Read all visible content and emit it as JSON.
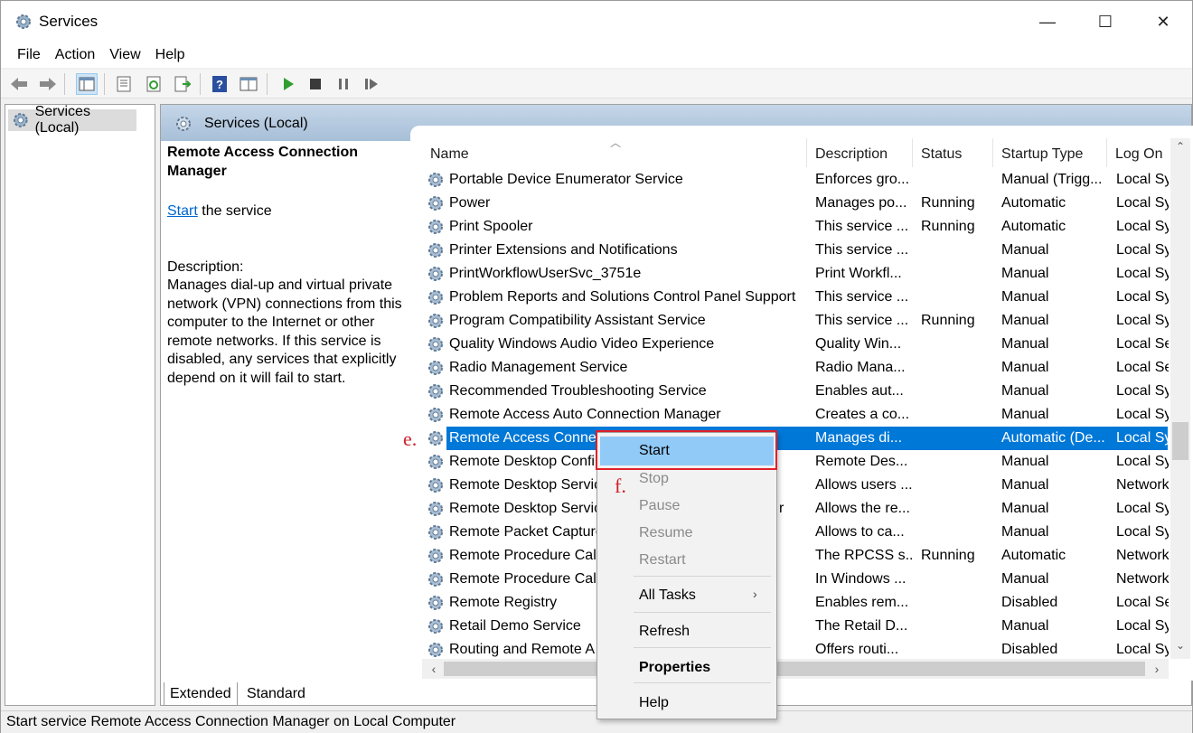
{
  "window": {
    "title": "Services",
    "controls": {
      "minimize": "—",
      "maximize": "☐",
      "close": "✕"
    }
  },
  "menu": [
    "File",
    "Action",
    "View",
    "Help"
  ],
  "toolbar": {
    "icons": [
      "back-arrow-icon",
      "forward-arrow-icon",
      "show-console-tree-icon",
      "properties-icon",
      "refresh-icon",
      "export-list-icon",
      "help-icon",
      "console-view-icon",
      "play-icon",
      "stop-icon",
      "pause-icon",
      "restart-icon"
    ]
  },
  "tree": {
    "root_label": "Services (Local)"
  },
  "pane": {
    "header": "Services (Local)"
  },
  "description": {
    "service_name_line1": "Remote Access Connection",
    "service_name_line2": "Manager",
    "start_link": "Start",
    "start_suffix": " the service",
    "label": "Description:",
    "text_lines": [
      "Manages dial-up and virtual private",
      "network (VPN) connections from this",
      "computer to the Internet or other",
      "remote networks. If this service is",
      "disabled, any services that explicitly",
      "depend on it will fail to start."
    ]
  },
  "table": {
    "columns": [
      "Name",
      "Description",
      "Status",
      "Startup Type",
      "Log On A"
    ],
    "rows": [
      {
        "name": "Portable Device Enumerator Service",
        "description": "Enforces gro...",
        "status": "",
        "startup": "Manual (Trigg...",
        "logon": "Local Sys"
      },
      {
        "name": "Power",
        "description": "Manages po...",
        "status": "Running",
        "startup": "Automatic",
        "logon": "Local Sys"
      },
      {
        "name": "Print Spooler",
        "description": "This service ...",
        "status": "Running",
        "startup": "Automatic",
        "logon": "Local Sys"
      },
      {
        "name": "Printer Extensions and Notifications",
        "description": "This service ...",
        "status": "",
        "startup": "Manual",
        "logon": "Local Sys"
      },
      {
        "name": "PrintWorkflowUserSvc_3751e",
        "description": "Print Workfl...",
        "status": "",
        "startup": "Manual",
        "logon": "Local Sys"
      },
      {
        "name": "Problem Reports and Solutions Control Panel Support",
        "description": "This service ...",
        "status": "",
        "startup": "Manual",
        "logon": "Local Sys"
      },
      {
        "name": "Program Compatibility Assistant Service",
        "description": "This service ...",
        "status": "Running",
        "startup": "Manual",
        "logon": "Local Sys"
      },
      {
        "name": "Quality Windows Audio Video Experience",
        "description": "Quality Win...",
        "status": "",
        "startup": "Manual",
        "logon": "Local Ser"
      },
      {
        "name": "Radio Management Service",
        "description": "Radio Mana...",
        "status": "",
        "startup": "Manual",
        "logon": "Local Ser"
      },
      {
        "name": "Recommended Troubleshooting Service",
        "description": "Enables aut...",
        "status": "",
        "startup": "Manual",
        "logon": "Local Sys"
      },
      {
        "name": "Remote Access Auto Connection Manager",
        "description": "Creates a co...",
        "status": "",
        "startup": "Manual",
        "logon": "Local Sys"
      },
      {
        "name": "Remote Access Connec",
        "description": "Manages di...",
        "status": "",
        "startup": "Automatic (De...",
        "logon": "Local Sys"
      },
      {
        "name": "Remote Desktop Confi",
        "description": "Remote Des...",
        "status": "",
        "startup": "Manual",
        "logon": "Local Sys"
      },
      {
        "name": "Remote Desktop Servic",
        "description": "Allows users ...",
        "status": "",
        "startup": "Manual",
        "logon": "Network"
      },
      {
        "name": "Remote Desktop Servic",
        "description": "Allows the re...",
        "status": "",
        "startup": "Manual",
        "logon": "Local Sys"
      },
      {
        "name": "Remote Packet Capture",
        "description": "Allows to ca...",
        "status": "",
        "startup": "Manual",
        "logon": "Local Sys"
      },
      {
        "name": "Remote Procedure Call",
        "description": "The RPCSS s...",
        "status": "Running",
        "startup": "Automatic",
        "logon": "Network"
      },
      {
        "name": "Remote Procedure Call",
        "description": "In Windows ...",
        "status": "",
        "startup": "Manual",
        "logon": "Network"
      },
      {
        "name": "Remote Registry",
        "description": "Enables rem...",
        "status": "",
        "startup": "Disabled",
        "logon": "Local Ser"
      },
      {
        "name": "Retail Demo Service",
        "description": "The Retail D...",
        "status": "",
        "startup": "Manual",
        "logon": "Local Sys"
      },
      {
        "name": "Routing and Remote A",
        "description": "Offers routi...",
        "status": "",
        "startup": "Disabled",
        "logon": "Local Sys"
      }
    ],
    "selected_index": 11,
    "partial_r": "r"
  },
  "context_menu": {
    "items": [
      {
        "label": "Start",
        "enabled": true
      },
      {
        "label": "Stop",
        "enabled": false
      },
      {
        "label": "Pause",
        "enabled": false
      },
      {
        "label": "Resume",
        "enabled": false
      },
      {
        "label": "Restart",
        "enabled": false
      },
      {
        "label": "All Tasks",
        "enabled": true,
        "submenu": true
      },
      {
        "label": "Refresh",
        "enabled": true
      },
      {
        "label": "Properties",
        "enabled": true,
        "bold": true
      },
      {
        "label": "Help",
        "enabled": true
      }
    ],
    "submenu_arrow": "›"
  },
  "tabs": [
    "Extended",
    "Standard"
  ],
  "status_bar": "Start service Remote Access Connection Manager on Local Computer",
  "annotations": {
    "e": "e.",
    "f": "f.",
    "color": "#d0202a"
  },
  "colors": {
    "selection": "#0078d7",
    "header_gradient": "#a7bfd8",
    "menu_highlight": "#91c9f7",
    "link": "#0066cc"
  }
}
